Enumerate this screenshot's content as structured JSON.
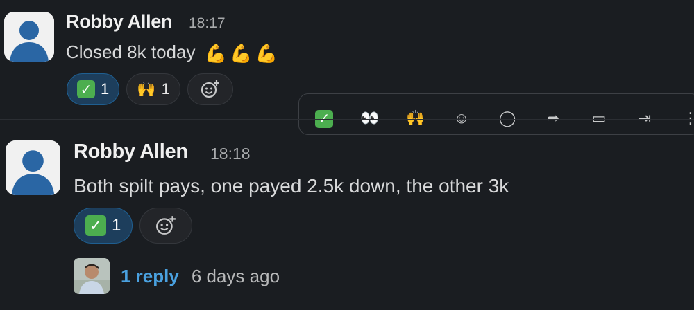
{
  "messages": [
    {
      "author": "Robby Allen",
      "time": "18:17",
      "text": "Closed 8k today",
      "emoji_trailing": [
        "flexed-biceps",
        "flexed-biceps",
        "flexed-biceps"
      ],
      "reactions": [
        {
          "emoji": "white-check-mark",
          "count": "1",
          "active": true
        },
        {
          "emoji": "raising-hands",
          "count": "1",
          "active": false
        }
      ]
    },
    {
      "author": "Robby Allen",
      "time": "18:18",
      "text": "Both spilt pays, one payed 2.5k down, the other 3k",
      "reactions": [
        {
          "emoji": "white-check-mark",
          "count": "1",
          "active": true
        }
      ],
      "thread": {
        "reply_label": "1 reply",
        "last_reply": "6 days ago"
      }
    }
  ],
  "toolbar": {
    "icons": [
      "white-check-mark",
      "eyes",
      "raising-hands",
      "add-reaction",
      "reply-in-thread",
      "forward",
      "save-for-later",
      "more-actions",
      "more"
    ]
  },
  "colors": {
    "background": "#1a1d21",
    "reaction_active": "#1d3e5c",
    "link": "#4aa1e0",
    "check": "#4cae4f"
  }
}
